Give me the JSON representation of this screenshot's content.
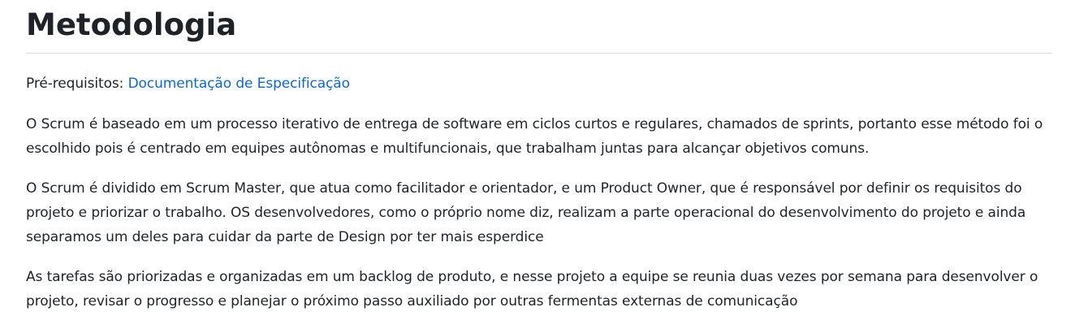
{
  "heading": "Metodologia",
  "prerequisites": {
    "label": "Pré-requisitos: ",
    "link_text": "Documentação de Especificação"
  },
  "paragraphs": [
    "O Scrum é baseado em um processo iterativo de entrega de software em ciclos curtos e regulares, chamados de sprints, portanto esse método foi o escolhido pois é centrado em equipes autônomas e multifuncionais, que trabalham juntas para alcançar objetivos comuns.",
    "O Scrum é dividido em Scrum Master, que atua como facilitador e orientador, e um Product Owner, que é responsável por definir os requisitos do projeto e priorizar o trabalho. OS desenvolvedores, como o próprio nome diz, realizam a parte operacional do desenvolvimento do projeto e ainda separamos um deles para cuidar da parte de Design por ter mais esperdice",
    "As tarefas são priorizadas e organizadas em um backlog de produto, e nesse projeto a equipe se reunia duas vezes por semana para desenvolver o projeto, revisar o progresso e planejar o próximo passo auxiliado por outras fermentas externas de comunicação"
  ],
  "colors": {
    "text": "#1f2328",
    "link": "#0969da",
    "divider": "#d8dee4"
  }
}
